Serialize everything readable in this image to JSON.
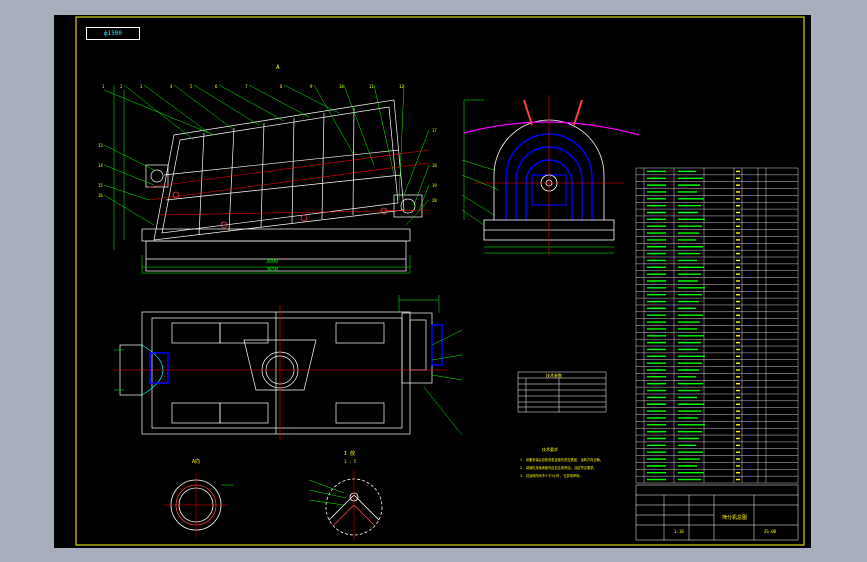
{
  "drawing": {
    "tag_text": "ф1500",
    "view_label_top": "A",
    "section_a_label": "A向",
    "section_b_label": "I 放",
    "section_b_scale": "1 : 5",
    "tech_req_title": "技术要求",
    "tech_req_lines": [
      "1. 设备安装后应检查各连接件是否紧固, 运转方向正确。",
      "2. 减速机及轴承座内应加注润滑油, 油位符合要求。",
      "3. 试运转时间不少于2小时, 无异常声响。"
    ],
    "small_table_title": "技术参数",
    "title_block_name": "筛分机总图",
    "title_block_code": "ZS-00",
    "title_block_scale": "1:10",
    "dimension_bottom": "3650",
    "dimension_bottom_sub": "3000"
  },
  "colors": {
    "background": "#a8aebb",
    "sheet": "#000000",
    "border": "#ffff00",
    "outline": "#ffffff",
    "dimension": "#00ff00",
    "centerline": "#ff0000",
    "section": "#0000ff",
    "text": "#ffff00",
    "accent": "#ff00ff",
    "cyan": "#00ffff"
  }
}
